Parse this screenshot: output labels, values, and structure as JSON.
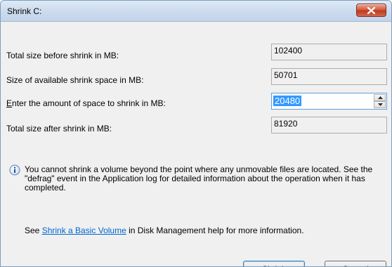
{
  "window": {
    "title": "Shrink C:"
  },
  "fields": {
    "total_before_label_pre": "",
    "total_before_label": "Total size before shrink in MB:",
    "total_before_value": "102400",
    "available_label": "Size of available shrink space in MB:",
    "available_value": "50701",
    "enter_amount_key": "E",
    "enter_amount_label_rest": "nter the amount of space to shrink in MB:",
    "enter_amount_value": "20480",
    "total_after_label": "Total size after shrink in MB:",
    "total_after_value": "81920"
  },
  "info": {
    "text": "You cannot shrink a volume beyond the point where any unmovable files are located. See the \"defrag\" event in the Application log for detailed information about the operation when it has completed."
  },
  "help": {
    "prefix": "See ",
    "link": "Shrink a Basic Volume",
    "suffix": " in Disk Management help for more information."
  },
  "buttons": {
    "shrink": "Shrink",
    "cancel_key": "C",
    "cancel_rest": "ancel"
  },
  "colors": {
    "link": "#0066cc",
    "selection": "#3399ff",
    "close_button": "#c1391a"
  },
  "icons": {
    "close": "close-x-icon",
    "info": "info-icon",
    "spin_up": "chevron-up-icon",
    "spin_down": "chevron-down-icon"
  }
}
